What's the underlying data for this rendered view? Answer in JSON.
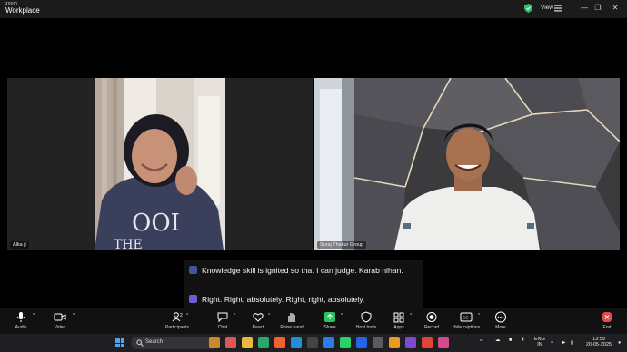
{
  "window": {
    "brand_small": "zoom",
    "brand_big": "Workplace",
    "view_label": "View"
  },
  "participants": [
    {
      "name": "Alka ji"
    },
    {
      "name": "Suraj Thakur Group"
    }
  ],
  "captions": [
    {
      "text": "Knowledge skill is ignited so that I can judge. Karab nihan.",
      "avatar_color": "#3b5a9a"
    },
    {
      "text": "Right. Right, absolutely. Right, right, absolutely.",
      "avatar_color": "#6f5bd6"
    }
  ],
  "toolbar": {
    "audio": "Audio",
    "video": "Video",
    "participants": "Participants",
    "participants_count": "2",
    "chat": "Chat",
    "react": "React",
    "raise_hand": "Raise hand",
    "share": "Share",
    "host_tools": "Host tools",
    "apps": "Apps",
    "record": "Record",
    "hide_captions": "Hide captions",
    "more": "More",
    "end": "End"
  },
  "taskbar": {
    "search_placeholder": "Search",
    "language_line1": "ENG",
    "language_line2": "IN",
    "time": "13:59",
    "date": "20-05-2025"
  },
  "colors": {
    "accent": "#0b5cff",
    "share_green": "#22c55e",
    "end_red": "#e5484d",
    "shield_green": "#2fbf71"
  }
}
